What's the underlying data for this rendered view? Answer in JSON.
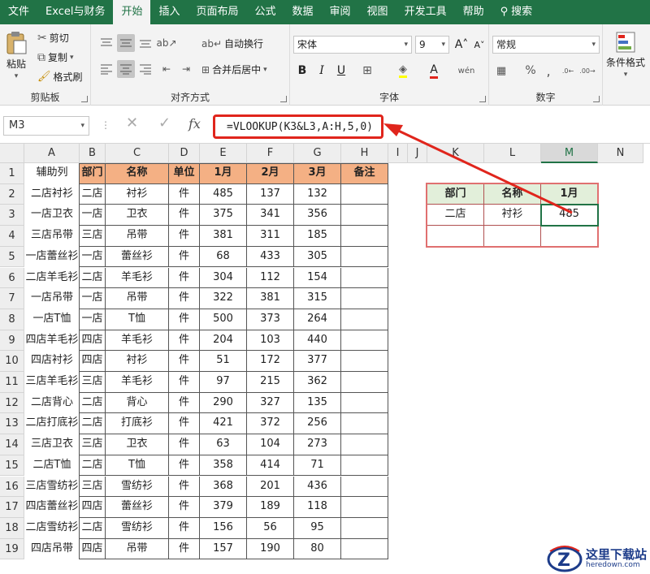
{
  "tabs": [
    {
      "label": "文件",
      "active": false
    },
    {
      "label": "Excel与财务",
      "active": false
    },
    {
      "label": "开始",
      "active": true
    },
    {
      "label": "插入",
      "active": false
    },
    {
      "label": "页面布局",
      "active": false
    },
    {
      "label": "公式",
      "active": false
    },
    {
      "label": "数据",
      "active": false
    },
    {
      "label": "审阅",
      "active": false
    },
    {
      "label": "视图",
      "active": false
    },
    {
      "label": "开发工具",
      "active": false
    },
    {
      "label": "帮助",
      "active": false
    }
  ],
  "search_label": "搜索",
  "clipboard": {
    "paste": "粘贴",
    "cut": "剪切",
    "copy": "复制",
    "format_painter": "格式刷",
    "group": "剪贴板"
  },
  "alignment": {
    "wrap": "自动换行",
    "merge": "合并后居中",
    "group": "对齐方式"
  },
  "font": {
    "name": "宋体",
    "size": "9",
    "group": "字体"
  },
  "number": {
    "format": "常规",
    "group": "数字"
  },
  "styles": {
    "cond_format": "条件格式"
  },
  "formula_bar": {
    "name_box": "M3",
    "formula": "=VLOOKUP(K3&L3,A:H,5,0)"
  },
  "columns": [
    "A",
    "B",
    "C",
    "D",
    "E",
    "F",
    "G",
    "H",
    "I",
    "J",
    "K",
    "L",
    "M",
    "N"
  ],
  "rows": [
    "1",
    "2",
    "3",
    "4",
    "5",
    "6",
    "7",
    "8",
    "9",
    "10",
    "11",
    "12",
    "13",
    "14",
    "15",
    "16",
    "17",
    "18",
    "19"
  ],
  "main_table": {
    "helper_header": "辅助列",
    "headers": [
      "部门",
      "名称",
      "单位",
      "1月",
      "2月",
      "3月",
      "备注"
    ],
    "rows": [
      [
        "二店衬衫",
        "二店",
        "衬衫",
        "件",
        "485",
        "137",
        "132"
      ],
      [
        "一店卫衣",
        "一店",
        "卫衣",
        "件",
        "375",
        "341",
        "356"
      ],
      [
        "三店吊带",
        "三店",
        "吊带",
        "件",
        "381",
        "311",
        "185"
      ],
      [
        "一店蕾丝衫",
        "一店",
        "蕾丝衫",
        "件",
        "68",
        "433",
        "305"
      ],
      [
        "二店羊毛衫",
        "二店",
        "羊毛衫",
        "件",
        "304",
        "112",
        "154"
      ],
      [
        "一店吊带",
        "一店",
        "吊带",
        "件",
        "322",
        "381",
        "315"
      ],
      [
        "一店T恤",
        "一店",
        "T恤",
        "件",
        "500",
        "373",
        "264"
      ],
      [
        "四店羊毛衫",
        "四店",
        "羊毛衫",
        "件",
        "204",
        "103",
        "440"
      ],
      [
        "四店衬衫",
        "四店",
        "衬衫",
        "件",
        "51",
        "172",
        "377"
      ],
      [
        "三店羊毛衫",
        "三店",
        "羊毛衫",
        "件",
        "97",
        "215",
        "362"
      ],
      [
        "二店背心",
        "二店",
        "背心",
        "件",
        "290",
        "327",
        "135"
      ],
      [
        "二店打底衫",
        "二店",
        "打底衫",
        "件",
        "421",
        "372",
        "256"
      ],
      [
        "三店卫衣",
        "三店",
        "卫衣",
        "件",
        "63",
        "104",
        "273"
      ],
      [
        "二店T恤",
        "二店",
        "T恤",
        "件",
        "358",
        "414",
        "71"
      ],
      [
        "三店雪纺衫",
        "三店",
        "雪纺衫",
        "件",
        "368",
        "201",
        "436"
      ],
      [
        "四店蕾丝衫",
        "四店",
        "蕾丝衫",
        "件",
        "379",
        "189",
        "118"
      ],
      [
        "二店雪纺衫",
        "二店",
        "雪纺衫",
        "件",
        "156",
        "56",
        "95"
      ],
      [
        "四店吊带",
        "四店",
        "吊带",
        "件",
        "157",
        "190",
        "80"
      ]
    ]
  },
  "lookup_table": {
    "headers": [
      "部门",
      "名称",
      "1月"
    ],
    "row": [
      "二店",
      "衬衫",
      "485"
    ]
  },
  "watermark": {
    "title": "这里下载站",
    "sub": "heredown.com"
  },
  "colors": {
    "ribbon": "#217346",
    "header_fill": "#f4b084",
    "highlight": "#e0251c",
    "lookup_header": "#e2efda"
  }
}
